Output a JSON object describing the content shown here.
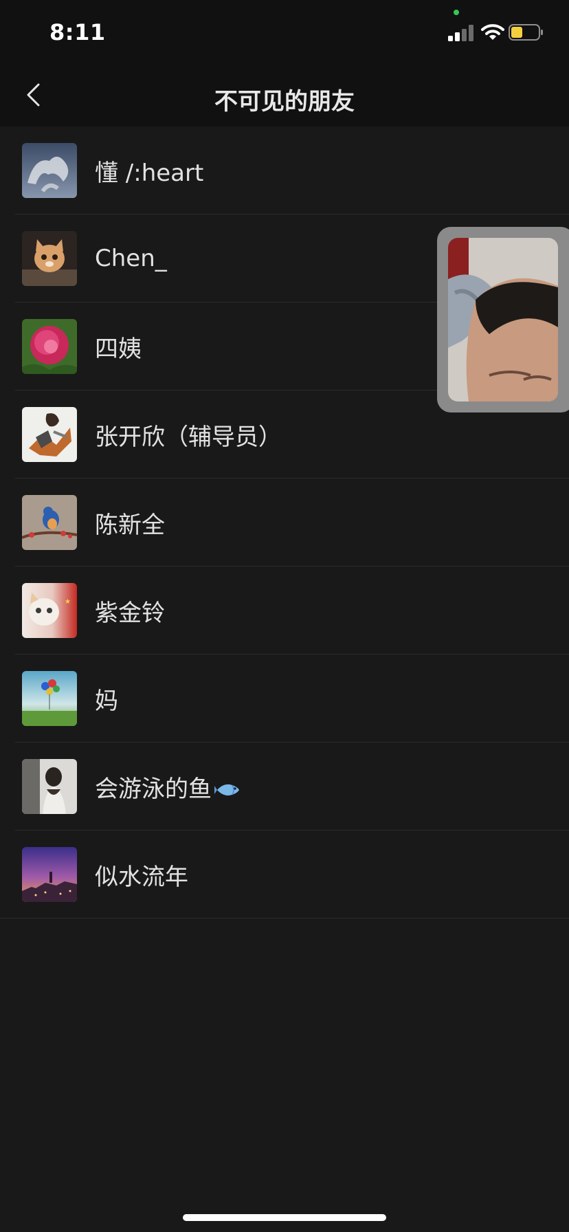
{
  "status_bar": {
    "time": "8:11",
    "icons": [
      "signal-icon",
      "wifi-icon",
      "battery-icon"
    ],
    "battery_color": "#f4d03f",
    "privacy_dot_color": "#34c759"
  },
  "nav": {
    "title": "不可见的朋友",
    "back_icon": "chevron-left-icon"
  },
  "friends": [
    {
      "name": "懂 /:heart"
    },
    {
      "name": "Chen_"
    },
    {
      "name": "四姨"
    },
    {
      "name": "张开欣（辅导员）"
    },
    {
      "name": "陈新全"
    },
    {
      "name": "紫金铃"
    },
    {
      "name": "妈"
    },
    {
      "name": "会游泳的鱼",
      "emoji_icon": "fish-icon"
    },
    {
      "name": "似水流年"
    }
  ],
  "colors": {
    "background": "#191919",
    "header": "#111111",
    "divider": "#2c2c2c",
    "text": "#e2e2e2"
  }
}
